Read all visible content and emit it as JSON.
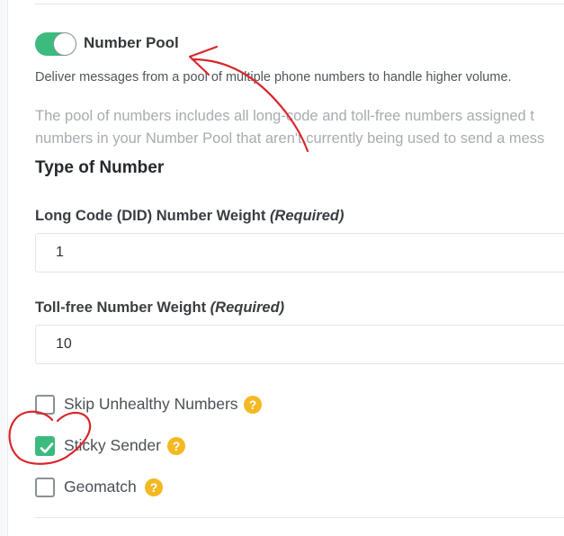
{
  "number_pool": {
    "toggle_on": true,
    "title": "Number Pool",
    "description": "Deliver messages from a pool of multiple phone numbers to handle higher volume.",
    "help_line_1": "The pool of numbers includes all long-code and toll-free numbers assigned t",
    "help_line_2": "numbers in your Number Pool that aren't currently being used to send a mess"
  },
  "type_of_number": {
    "heading": "Type of Number",
    "long_code": {
      "label": "Long Code (DID) Number Weight",
      "required": "(Required)",
      "value": "1"
    },
    "toll_free": {
      "label": "Toll-free Number Weight",
      "required": "(Required)",
      "value": "10"
    }
  },
  "options": [
    {
      "label": "Skip Unhealthy Numbers",
      "checked": false,
      "help": "?"
    },
    {
      "label": "Sticky Sender",
      "checked": true,
      "help": "?"
    },
    {
      "label": "Geomatch",
      "checked": false,
      "help": "?"
    }
  ],
  "colors": {
    "accent_green": "#3dba7e",
    "help_yellow": "#f4b922",
    "annotation_red": "#d9262b"
  }
}
